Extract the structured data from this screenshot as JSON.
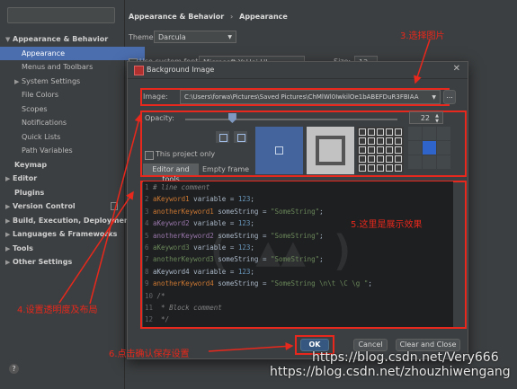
{
  "sidebar": {
    "search_placeholder": "",
    "items": [
      {
        "label": "Appearance & Behavior",
        "arrow": "▼",
        "indent": 6,
        "bold": true
      },
      {
        "label": "Appearance",
        "selected": true,
        "indent": 24
      },
      {
        "label": "Menus and Toolbars",
        "indent": 24
      },
      {
        "label": "System Settings",
        "arrow": "▶",
        "indent": 16
      },
      {
        "label": "File Colors",
        "indent": 24,
        "copy": true
      },
      {
        "label": "Scopes",
        "indent": 24,
        "copy": true
      },
      {
        "label": "Notifications",
        "indent": 24
      },
      {
        "label": "Quick Lists",
        "indent": 24
      },
      {
        "label": "Path Variables",
        "indent": 24
      },
      {
        "label": "Keymap",
        "indent": 16,
        "bold": true
      },
      {
        "label": "Editor",
        "arrow": "▶",
        "indent": 6,
        "bold": true
      },
      {
        "label": "Plugins",
        "indent": 16,
        "bold": true
      },
      {
        "label": "Version Control",
        "arrow": "▶",
        "indent": 6,
        "bold": true,
        "copy": true
      },
      {
        "label": "Build, Execution, Deployment",
        "arrow": "▶",
        "indent": 6,
        "bold": true
      },
      {
        "label": "Languages & Frameworks",
        "arrow": "▶",
        "indent": 6,
        "bold": true
      },
      {
        "label": "Tools",
        "arrow": "▶",
        "indent": 6,
        "bold": true
      },
      {
        "label": "Other Settings",
        "arrow": "▶",
        "indent": 6,
        "bold": true
      }
    ],
    "help": "?"
  },
  "header": {
    "crumb1": "Appearance & Behavior",
    "sep": "›",
    "crumb2": "Appearance",
    "theme_label": "Theme:",
    "theme_value": "Darcula",
    "custom_font_label": "Use custom font:",
    "font_value": "Microsoft YaHei UI",
    "size_label": "Size:",
    "size_value": "12"
  },
  "dialog": {
    "title": "Background Image",
    "close": "✕",
    "image_label": "Image:",
    "image_path": "C:\\Users\\forwa\\Pictures\\Saved Pictures\\ChMlWl0IwkilOe1bABEFDuR3FBIAA",
    "browse": "...",
    "opacity_label": "Opacity:",
    "opacity_value": "22",
    "opacity_fraction": 0.22,
    "this_project_only": "This project only",
    "tab_editor": "Editor and tools",
    "tab_empty": "Empty frame",
    "ok": "OK",
    "cancel": "Cancel",
    "clear_close": "Clear and Close"
  },
  "code_lines": [
    {
      "num": "1",
      "parts": [
        {
          "t": "# line comment",
          "c": "c"
        }
      ]
    },
    {
      "num": "2",
      "parts": [
        {
          "t": "aKeyword1",
          "c": "kw1"
        },
        {
          "t": " variable = ",
          "c": "v"
        },
        {
          "t": "123",
          "c": "n"
        },
        {
          "t": ";",
          "c": "v"
        }
      ]
    },
    {
      "num": "3",
      "parts": [
        {
          "t": "anotherKeyword1",
          "c": "kw1"
        },
        {
          "t": " someString = ",
          "c": "v"
        },
        {
          "t": "\"SomeString\"",
          "c": "s"
        },
        {
          "t": ";",
          "c": "v"
        }
      ]
    },
    {
      "num": "4",
      "parts": [
        {
          "t": "aKeyword2",
          "c": "kw2"
        },
        {
          "t": " variable = ",
          "c": "v"
        },
        {
          "t": "123",
          "c": "n"
        },
        {
          "t": ";",
          "c": "v"
        }
      ]
    },
    {
      "num": "5",
      "parts": [
        {
          "t": "anotherKeyword2",
          "c": "kw2"
        },
        {
          "t": " someString = ",
          "c": "v"
        },
        {
          "t": "\"SomeString\"",
          "c": "s"
        },
        {
          "t": ";",
          "c": "v"
        }
      ]
    },
    {
      "num": "6",
      "parts": [
        {
          "t": "aKeyword3",
          "c": "kw3"
        },
        {
          "t": " variable = ",
          "c": "v"
        },
        {
          "t": "123",
          "c": "n"
        },
        {
          "t": ";",
          "c": "v"
        }
      ]
    },
    {
      "num": "7",
      "parts": [
        {
          "t": "anotherKeyword3",
          "c": "kw3"
        },
        {
          "t": " someString = ",
          "c": "v"
        },
        {
          "t": "\"SomeString\"",
          "c": "s"
        },
        {
          "t": ";",
          "c": "v"
        }
      ]
    },
    {
      "num": "8",
      "parts": [
        {
          "t": "aKeyword4",
          "c": "kw4"
        },
        {
          "t": " variable = ",
          "c": "v"
        },
        {
          "t": "123",
          "c": "n"
        },
        {
          "t": ";",
          "c": "v"
        }
      ]
    },
    {
      "num": "9",
      "parts": [
        {
          "t": "anotherKeyword4",
          "c": "kw1"
        },
        {
          "t": " someString = ",
          "c": "v"
        },
        {
          "t": "\"SomeString \\n\\t \\C \\g \"",
          "c": "s"
        },
        {
          "t": ";",
          "c": "v"
        }
      ]
    },
    {
      "num": "10",
      "parts": [
        {
          "t": "/*",
          "c": "c"
        }
      ]
    },
    {
      "num": "11",
      "parts": [
        {
          "t": " * Block comment",
          "c": "c"
        }
      ]
    },
    {
      "num": "12",
      "parts": [
        {
          "t": " */",
          "c": "c"
        }
      ]
    }
  ],
  "annotations": {
    "step3": "3.选择图片",
    "step4": "4.设置透明度及布局",
    "step5": "5.这里是展示效果",
    "step6": "6.点击确认保存设置"
  },
  "watermarks": {
    "line1": "https://blog.csdn.net/Very666",
    "line2": "https://blog.csdn.net/zhouzhiwengang"
  },
  "colors": {
    "accent": "#4b6eaf",
    "annotation_red": "#e8281c",
    "ok_blue": "#365880"
  }
}
